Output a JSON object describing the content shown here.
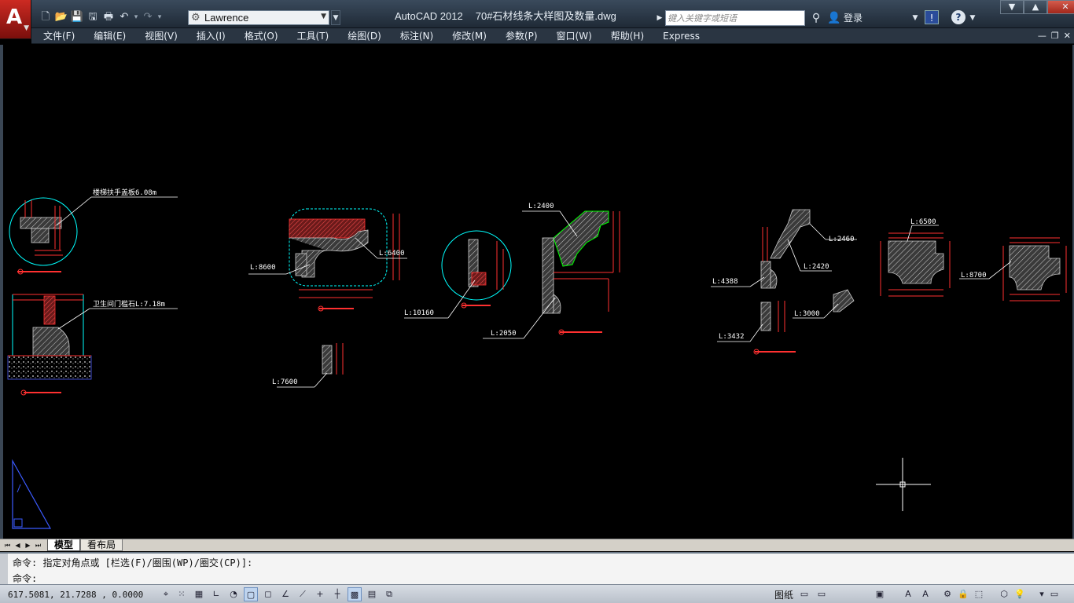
{
  "app": {
    "name": "AutoCAD 2012",
    "file": "70#石材线条大样图及数量.dwg"
  },
  "workspace": {
    "value": "Lawrence"
  },
  "search": {
    "placeholder": "键入关键字或短语"
  },
  "login": {
    "label": "登录"
  },
  "menus": [
    "文件(F)",
    "编辑(E)",
    "视图(V)",
    "插入(I)",
    "格式(O)",
    "工具(T)",
    "绘图(D)",
    "标注(N)",
    "修改(M)",
    "参数(P)",
    "窗口(W)",
    "帮助(H)",
    "Express"
  ],
  "drawing": {
    "labels": {
      "stair_handrail": "楼梯扶手盖板6.08m",
      "bathroom_threshold": "卫生间门槛石L:7.18m",
      "l8600": "L:8600",
      "l6400": "L:6400",
      "l7600": "L:7600",
      "l10160": "L:10160",
      "l2400": "L:2400",
      "l2050": "L:2050",
      "l2460": "L:2460",
      "l2420": "L:2420",
      "l4388": "L:4388",
      "l3000": "L:3000",
      "l3432": "L:3432",
      "l6500": "L:6500",
      "l8700": "L:8700"
    }
  },
  "tabs": {
    "model": "模型",
    "layout": "看布局"
  },
  "command": {
    "history": "命令: 指定对角点或 [栏选(F)/圈围(WP)/圈交(CP)]:",
    "prompt": "命令:"
  },
  "status": {
    "coords": "617.5081, 21.7288 , 0.0000",
    "paper": "图纸"
  },
  "colors": {
    "background": "#000000",
    "dimension": "#ff2a2a",
    "hatch": "#c03a3a",
    "detail": "#00ffff",
    "text": "#ffffff",
    "green": "#00ff00"
  },
  "icons": [
    "new-icon",
    "open-icon",
    "save-icon",
    "saveas-icon",
    "print-icon",
    "undo-icon",
    "redo-icon",
    "gear-icon",
    "search-icon",
    "binoculars-icon",
    "user-icon",
    "exchange-icon",
    "help-icon",
    "crosshair-icon",
    "ucs-icon"
  ]
}
